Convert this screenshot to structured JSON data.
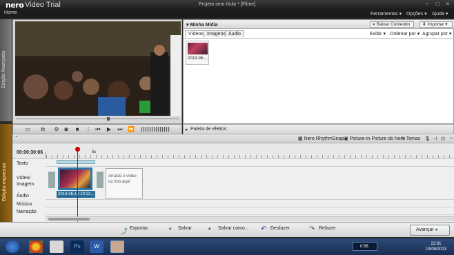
{
  "app": {
    "logo": "nero",
    "name": "Video Trial",
    "document_title": "Projeto sem título * [Filme]",
    "home": "Home"
  },
  "menus": [
    "Ferramentas",
    "Opções",
    "Ajuda"
  ],
  "side": {
    "advanced": "Edição Avançada",
    "express": "Edição expressa"
  },
  "media": {
    "title": "Minha Mídia",
    "download_btn": "Baixar Conteúdo",
    "import_btn": "Importar",
    "tabs": [
      "Vídeos",
      "Imagens",
      "Áudio"
    ],
    "view_menus": [
      "Exibir",
      "Ordenar por",
      "Agrupar por"
    ],
    "item_label": "2013-06-..."
  },
  "effects": {
    "label": "Paleta de efeitos:"
  },
  "toolbar2": {
    "rhythmsnap": "Nero RhythmSnap",
    "pip": "Picture-in-Picture do Nero",
    "themes": "Temas"
  },
  "timeline": {
    "timecode": "00:00:30:06",
    "ruler_mark": "5s",
    "tracks": [
      "Texto",
      "Vídeo/\nImagem",
      "Áudio",
      "Música",
      "Narração"
    ],
    "clip_label": "2013-06-13 20:22...",
    "drop_hint": "Arraste o vídeo ou foto aqui"
  },
  "bottom": {
    "export": "Exportar",
    "save": "Salvar",
    "save_as": "Salvar como...",
    "undo": "Desfazer",
    "redo": "Refazer",
    "next": "Avançar"
  },
  "taskbar": {
    "volume": "0:56",
    "time": "22:31",
    "date": "19/09/2013"
  },
  "colors": {
    "accent": "#d08a10",
    "playhead": "#d00000",
    "clip": "#2a6c98"
  }
}
